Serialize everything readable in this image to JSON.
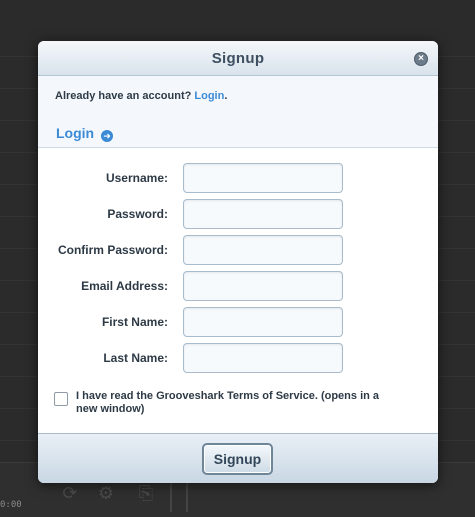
{
  "background": {
    "time_text": "0:00"
  },
  "modal": {
    "title": "Signup",
    "close_icon": "×",
    "already_text": "Already have an account?",
    "already_link": "Login",
    "already_period": ".",
    "login_heading": "Login",
    "arrow_icon": "➜"
  },
  "form": {
    "fields": [
      {
        "label": "Username:",
        "value": ""
      },
      {
        "label": "Password:",
        "value": ""
      },
      {
        "label": "Confirm Password:",
        "value": ""
      },
      {
        "label": "Email Address:",
        "value": ""
      },
      {
        "label": "First Name:",
        "value": ""
      },
      {
        "label": "Last Name:",
        "value": ""
      }
    ],
    "tos_text": "I have read the Grooveshark Terms of Service. (opens in a new window)",
    "tos_checked": false
  },
  "footer": {
    "signup_label": "Signup"
  },
  "colors": {
    "accent": "#3b8ad6",
    "header_bg": "#d9e3ec",
    "overlay_bg": "#2b2b2b"
  }
}
